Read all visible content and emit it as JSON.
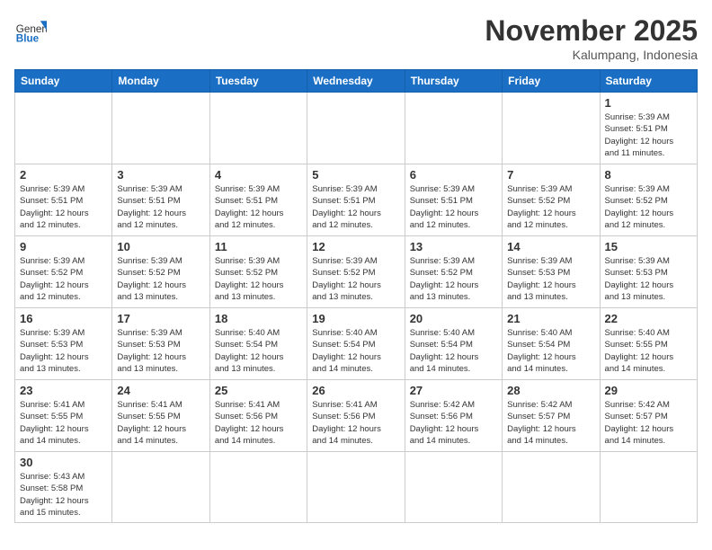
{
  "logo": {
    "general": "General",
    "blue": "Blue"
  },
  "title": "November 2025",
  "location": "Kalumpang, Indonesia",
  "weekdays": [
    "Sunday",
    "Monday",
    "Tuesday",
    "Wednesday",
    "Thursday",
    "Friday",
    "Saturday"
  ],
  "days": {
    "1": {
      "sunrise": "5:39 AM",
      "sunset": "5:51 PM",
      "daylight": "12 hours and 11 minutes."
    },
    "2": {
      "sunrise": "5:39 AM",
      "sunset": "5:51 PM",
      "daylight": "12 hours and 12 minutes."
    },
    "3": {
      "sunrise": "5:39 AM",
      "sunset": "5:51 PM",
      "daylight": "12 hours and 12 minutes."
    },
    "4": {
      "sunrise": "5:39 AM",
      "sunset": "5:51 PM",
      "daylight": "12 hours and 12 minutes."
    },
    "5": {
      "sunrise": "5:39 AM",
      "sunset": "5:51 PM",
      "daylight": "12 hours and 12 minutes."
    },
    "6": {
      "sunrise": "5:39 AM",
      "sunset": "5:51 PM",
      "daylight": "12 hours and 12 minutes."
    },
    "7": {
      "sunrise": "5:39 AM",
      "sunset": "5:52 PM",
      "daylight": "12 hours and 12 minutes."
    },
    "8": {
      "sunrise": "5:39 AM",
      "sunset": "5:52 PM",
      "daylight": "12 hours and 12 minutes."
    },
    "9": {
      "sunrise": "5:39 AM",
      "sunset": "5:52 PM",
      "daylight": "12 hours and 12 minutes."
    },
    "10": {
      "sunrise": "5:39 AM",
      "sunset": "5:52 PM",
      "daylight": "12 hours and 13 minutes."
    },
    "11": {
      "sunrise": "5:39 AM",
      "sunset": "5:52 PM",
      "daylight": "12 hours and 13 minutes."
    },
    "12": {
      "sunrise": "5:39 AM",
      "sunset": "5:52 PM",
      "daylight": "12 hours and 13 minutes."
    },
    "13": {
      "sunrise": "5:39 AM",
      "sunset": "5:52 PM",
      "daylight": "12 hours and 13 minutes."
    },
    "14": {
      "sunrise": "5:39 AM",
      "sunset": "5:53 PM",
      "daylight": "12 hours and 13 minutes."
    },
    "15": {
      "sunrise": "5:39 AM",
      "sunset": "5:53 PM",
      "daylight": "12 hours and 13 minutes."
    },
    "16": {
      "sunrise": "5:39 AM",
      "sunset": "5:53 PM",
      "daylight": "12 hours and 13 minutes."
    },
    "17": {
      "sunrise": "5:39 AM",
      "sunset": "5:53 PM",
      "daylight": "12 hours and 13 minutes."
    },
    "18": {
      "sunrise": "5:40 AM",
      "sunset": "5:54 PM",
      "daylight": "12 hours and 13 minutes."
    },
    "19": {
      "sunrise": "5:40 AM",
      "sunset": "5:54 PM",
      "daylight": "12 hours and 14 minutes."
    },
    "20": {
      "sunrise": "5:40 AM",
      "sunset": "5:54 PM",
      "daylight": "12 hours and 14 minutes."
    },
    "21": {
      "sunrise": "5:40 AM",
      "sunset": "5:54 PM",
      "daylight": "12 hours and 14 minutes."
    },
    "22": {
      "sunrise": "5:40 AM",
      "sunset": "5:55 PM",
      "daylight": "12 hours and 14 minutes."
    },
    "23": {
      "sunrise": "5:41 AM",
      "sunset": "5:55 PM",
      "daylight": "12 hours and 14 minutes."
    },
    "24": {
      "sunrise": "5:41 AM",
      "sunset": "5:55 PM",
      "daylight": "12 hours and 14 minutes."
    },
    "25": {
      "sunrise": "5:41 AM",
      "sunset": "5:56 PM",
      "daylight": "12 hours and 14 minutes."
    },
    "26": {
      "sunrise": "5:41 AM",
      "sunset": "5:56 PM",
      "daylight": "12 hours and 14 minutes."
    },
    "27": {
      "sunrise": "5:42 AM",
      "sunset": "5:56 PM",
      "daylight": "12 hours and 14 minutes."
    },
    "28": {
      "sunrise": "5:42 AM",
      "sunset": "5:57 PM",
      "daylight": "12 hours and 14 minutes."
    },
    "29": {
      "sunrise": "5:42 AM",
      "sunset": "5:57 PM",
      "daylight": "12 hours and 14 minutes."
    },
    "30": {
      "sunrise": "5:43 AM",
      "sunset": "5:58 PM",
      "daylight": "12 hours and 15 minutes."
    }
  },
  "labels": {
    "sunrise": "Sunrise:",
    "sunset": "Sunset:",
    "daylight": "Daylight:"
  }
}
